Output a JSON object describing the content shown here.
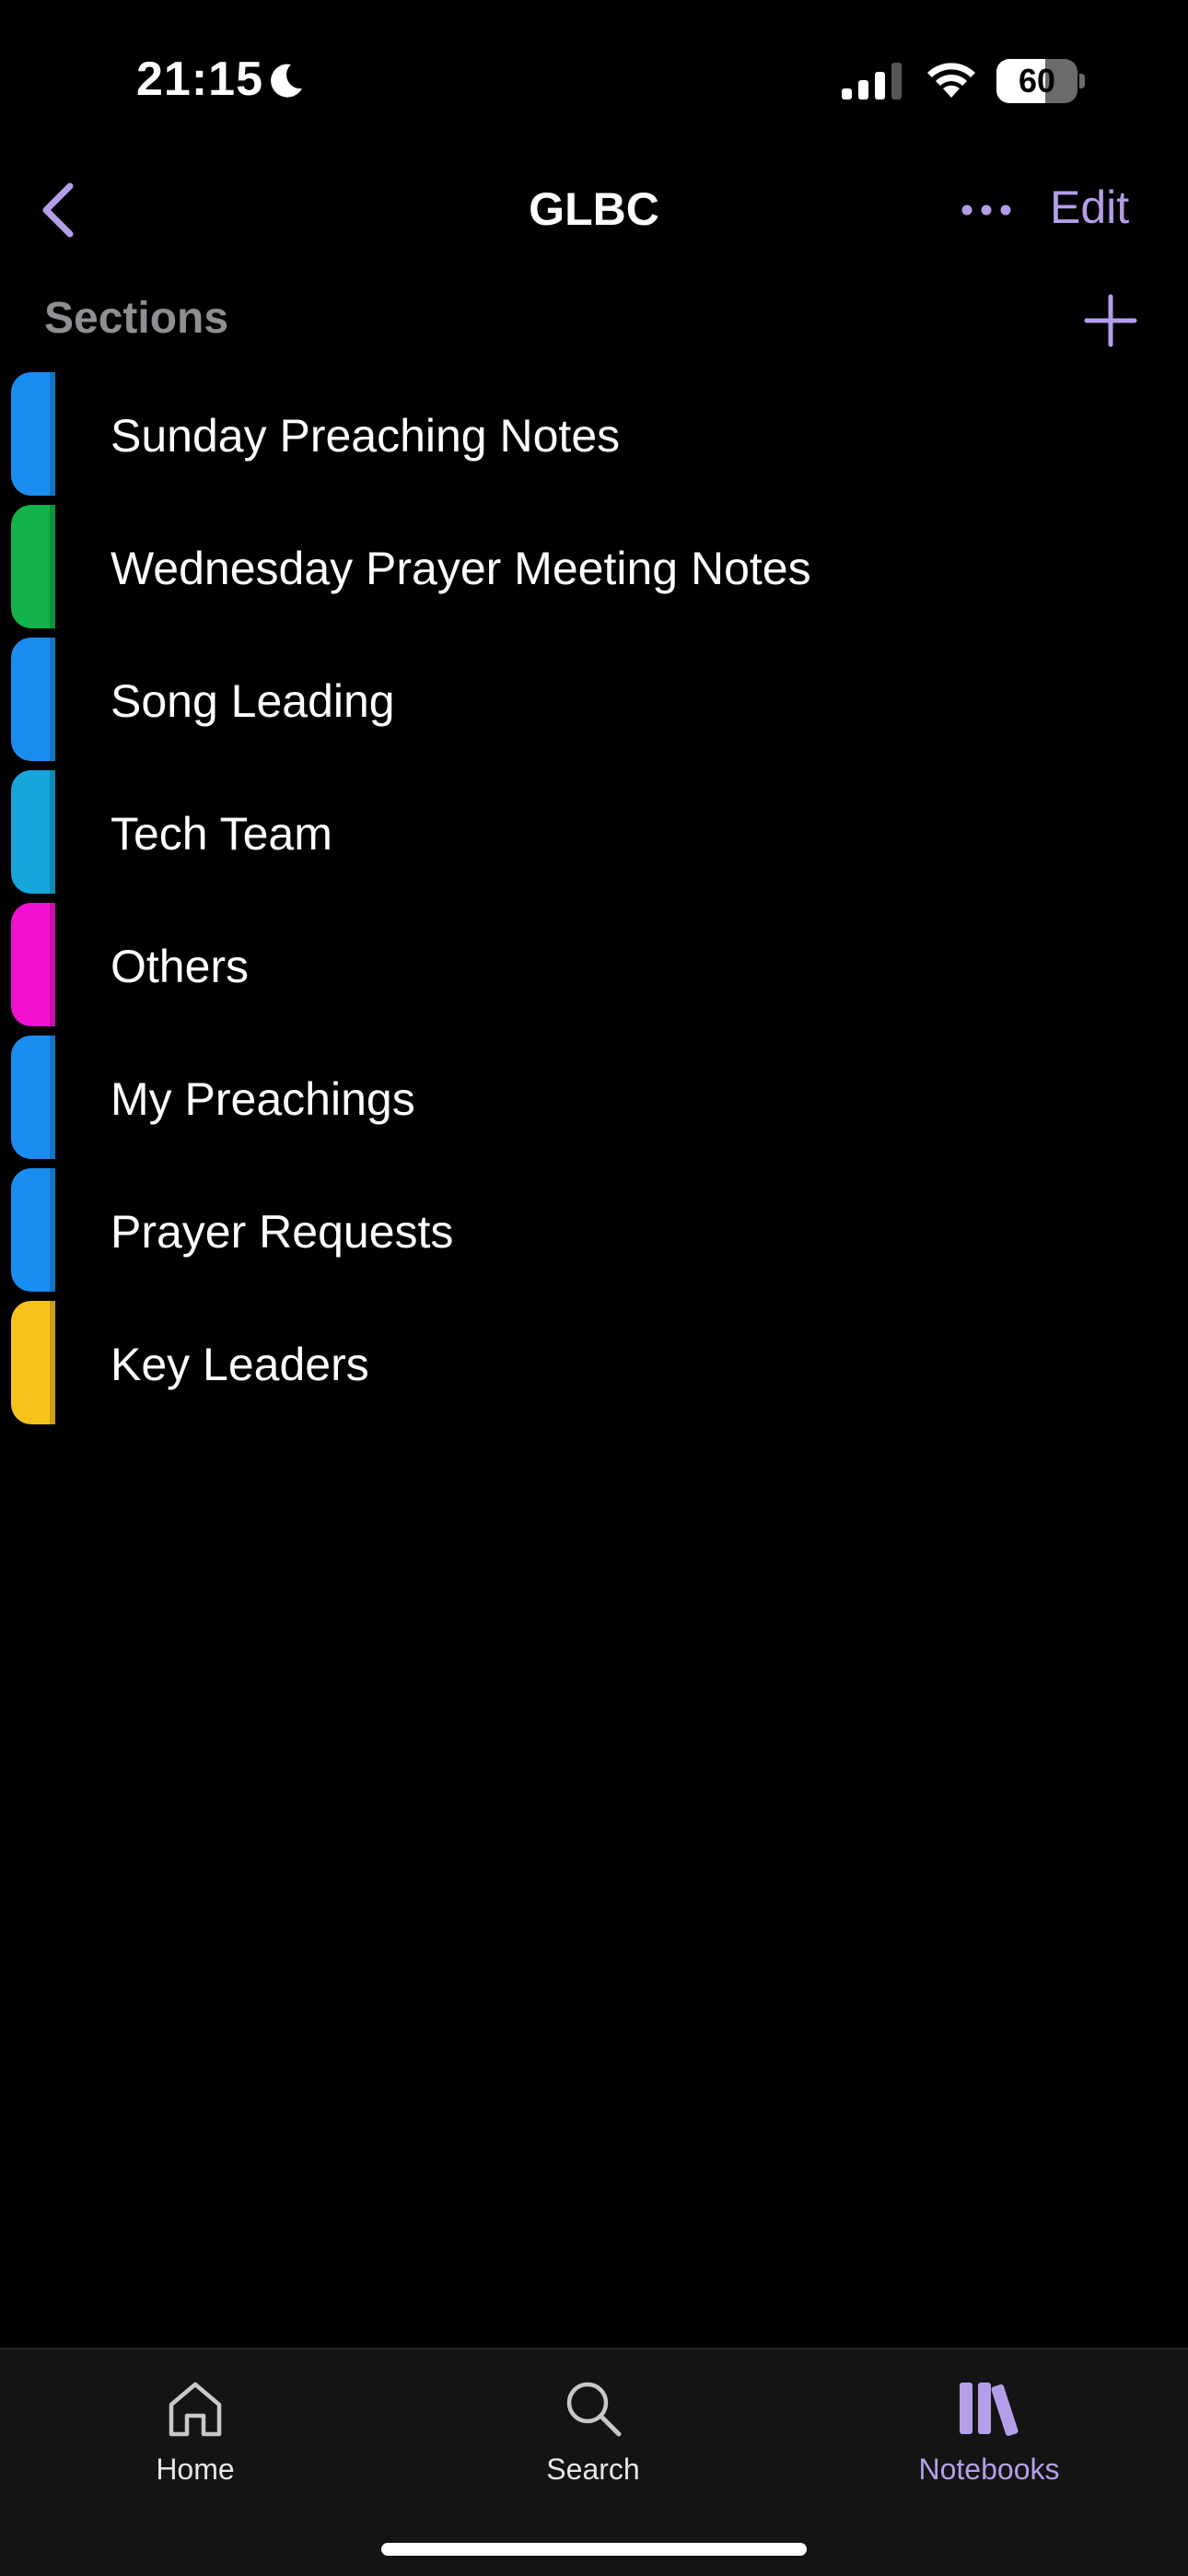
{
  "status_bar": {
    "time": "21:15",
    "battery_level": "60",
    "battery_fraction": 0.6,
    "icons": [
      "moon-icon",
      "cellular-signal-icon",
      "wifi-icon",
      "battery-icon"
    ]
  },
  "nav": {
    "title": "GLBC",
    "edit_label": "Edit",
    "back_icon": "chevron-left-icon",
    "more_icon": "ellipsis-icon"
  },
  "sections_header": {
    "label": "Sections",
    "add_icon": "plus-icon"
  },
  "sections": [
    {
      "label": "Sunday Preaching Notes",
      "color": "#1a8ef0"
    },
    {
      "label": "Wednesday Prayer Meeting Notes",
      "color": "#12b34a"
    },
    {
      "label": "Song Leading",
      "color": "#1a8ef0"
    },
    {
      "label": "Tech Team",
      "color": "#17a6db"
    },
    {
      "label": "Others",
      "color": "#f010cf"
    },
    {
      "label": "My Preachings",
      "color": "#1a8ef0"
    },
    {
      "label": "Prayer Requests",
      "color": "#1a8ef0"
    },
    {
      "label": "Key Leaders",
      "color": "#f8c21c"
    }
  ],
  "tab_bar": {
    "items": [
      {
        "label": "Home",
        "icon": "home-icon",
        "active": false
      },
      {
        "label": "Search",
        "icon": "search-icon",
        "active": false
      },
      {
        "label": "Notebooks",
        "icon": "notebooks-icon",
        "active": true
      }
    ]
  },
  "colors": {
    "accent": "#b49ee9",
    "background": "#000000",
    "secondary_text": "#8e8e93"
  }
}
